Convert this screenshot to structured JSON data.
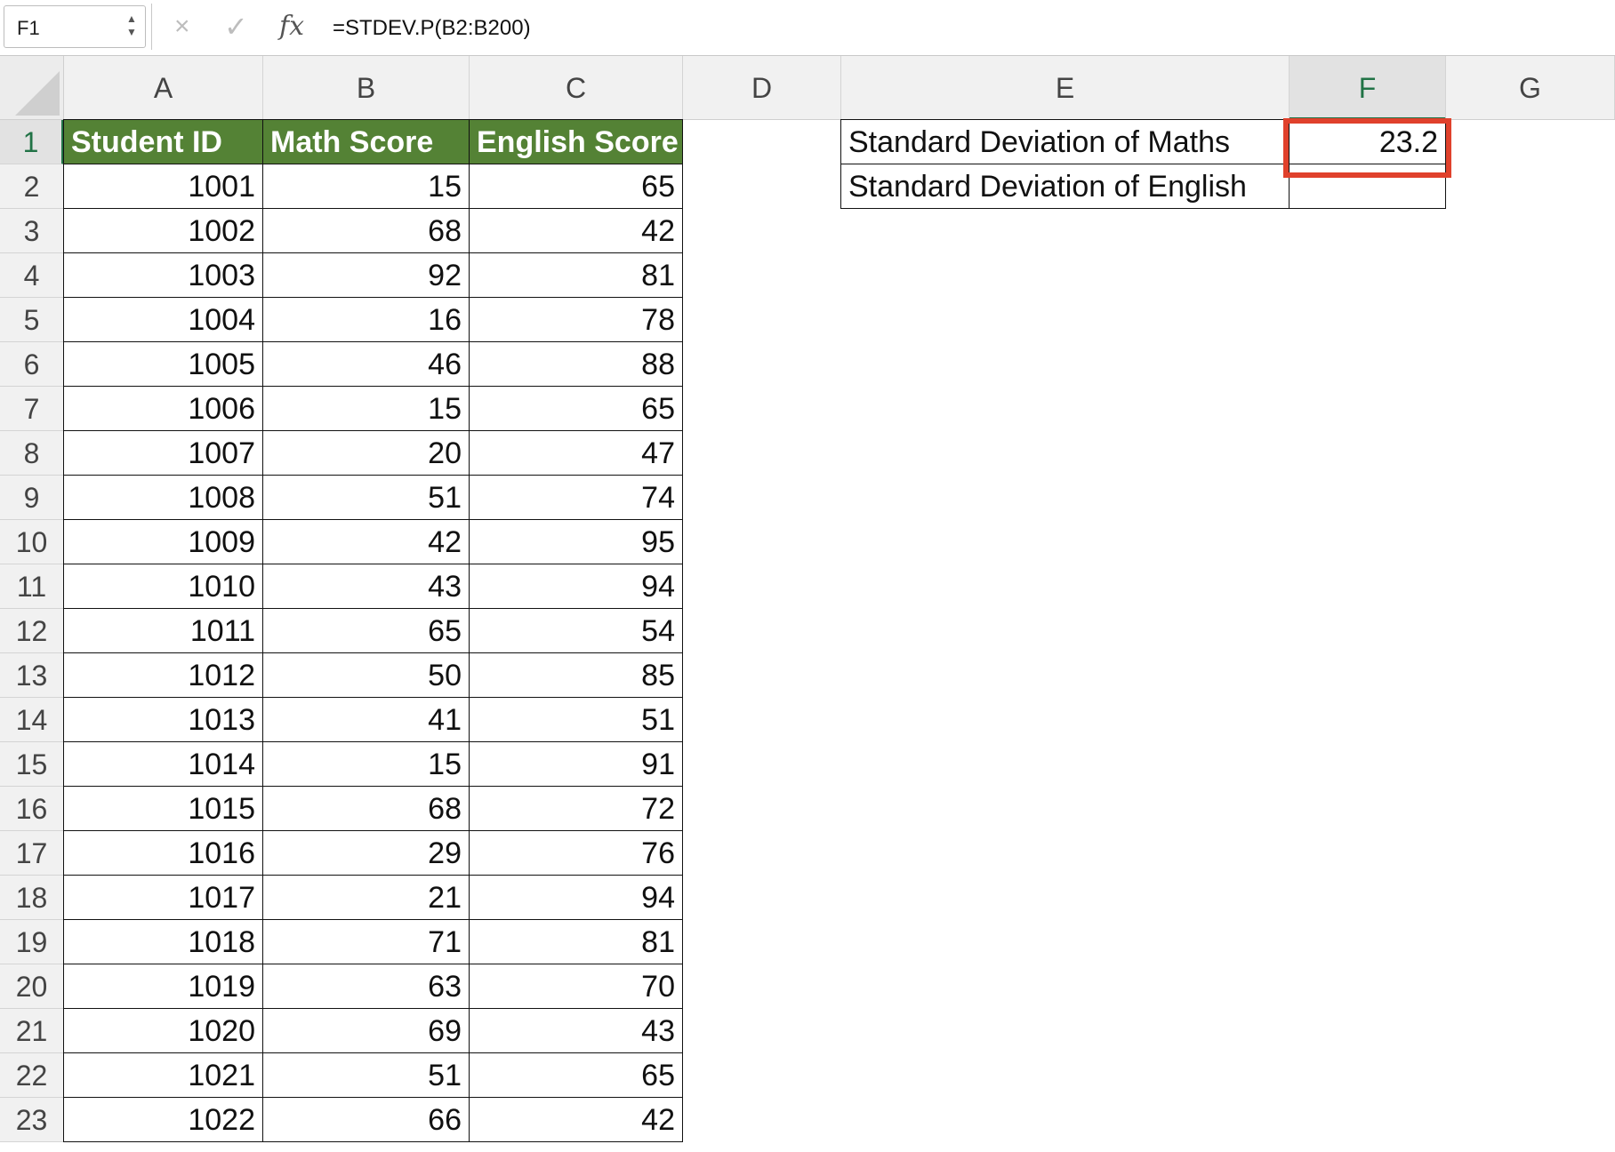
{
  "formula_bar": {
    "name_box": "F1",
    "formula": "=STDEV.P(B2:B200)",
    "fx_label": "fx",
    "cancel_icon": "×",
    "enter_icon": "✓"
  },
  "columns": [
    "A",
    "B",
    "C",
    "D",
    "E",
    "F",
    "G"
  ],
  "rows": [
    "1",
    "2",
    "3",
    "4",
    "5",
    "6",
    "7",
    "8",
    "9",
    "10",
    "11",
    "12",
    "13",
    "14",
    "15",
    "16",
    "17",
    "18",
    "19",
    "20",
    "21",
    "22",
    "23"
  ],
  "table": {
    "headers": [
      "Student ID",
      "Math Score",
      "English Score"
    ],
    "data": [
      [
        "1001",
        "15",
        "65"
      ],
      [
        "1002",
        "68",
        "42"
      ],
      [
        "1003",
        "92",
        "81"
      ],
      [
        "1004",
        "16",
        "78"
      ],
      [
        "1005",
        "46",
        "88"
      ],
      [
        "1006",
        "15",
        "65"
      ],
      [
        "1007",
        "20",
        "47"
      ],
      [
        "1008",
        "51",
        "74"
      ],
      [
        "1009",
        "42",
        "95"
      ],
      [
        "1010",
        "43",
        "94"
      ],
      [
        "1011",
        "65",
        "54"
      ],
      [
        "1012",
        "50",
        "85"
      ],
      [
        "1013",
        "41",
        "51"
      ],
      [
        "1014",
        "15",
        "91"
      ],
      [
        "1015",
        "68",
        "72"
      ],
      [
        "1016",
        "29",
        "76"
      ],
      [
        "1017",
        "21",
        "94"
      ],
      [
        "1018",
        "71",
        "81"
      ],
      [
        "1019",
        "63",
        "70"
      ],
      [
        "1020",
        "69",
        "43"
      ],
      [
        "1021",
        "51",
        "65"
      ],
      [
        "1022",
        "66",
        "42"
      ]
    ]
  },
  "summary": {
    "rows": [
      {
        "label": "Standard Deviation of Maths",
        "value": "23.2"
      },
      {
        "label": "Standard Deviation of English",
        "value": ""
      }
    ]
  },
  "selected_cell": "F1",
  "colors": {
    "header_fill": "#548235",
    "selection_highlight": "#e0412c",
    "active_header_text": "#217346"
  }
}
